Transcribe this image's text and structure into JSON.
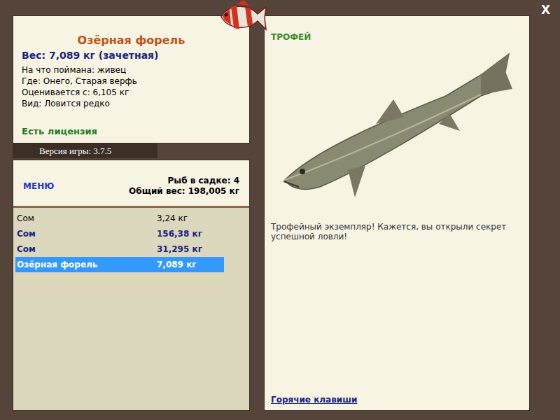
{
  "close": "X",
  "fish": {
    "name": "Озёрная форель",
    "weight": "Вес: 7,089 кг (зачетная)",
    "details": [
      "На что поймана: живец",
      "Где: Онего, Старая верфь",
      "Оценивается с: 6,105 кг",
      "Вид: Ловится редко"
    ],
    "license": "Есть лицензия"
  },
  "version": "Версия игры: 3.7.5",
  "menu": "МЕНЮ",
  "keepnet": {
    "count": "Рыб в садке: 4",
    "total": "Общий вес: 198,005 кг"
  },
  "catch": [
    {
      "name": "Сом",
      "weight": "3,24 кг",
      "trophy": false,
      "selected": false
    },
    {
      "name": "Сом",
      "weight": "156,38 кг",
      "trophy": true,
      "selected": false
    },
    {
      "name": "Сом",
      "weight": "31,295 кг",
      "trophy": true,
      "selected": false
    },
    {
      "name": "Озёрная форель",
      "weight": "7,089 кг",
      "trophy": true,
      "selected": true
    }
  ],
  "trophy": {
    "badge": "ТРОФЕЙ",
    "text": "Трофейный экземпляр! Кажется, вы открыли секрет успешной ловли!"
  },
  "hotkeys": "Горячие клавиши"
}
